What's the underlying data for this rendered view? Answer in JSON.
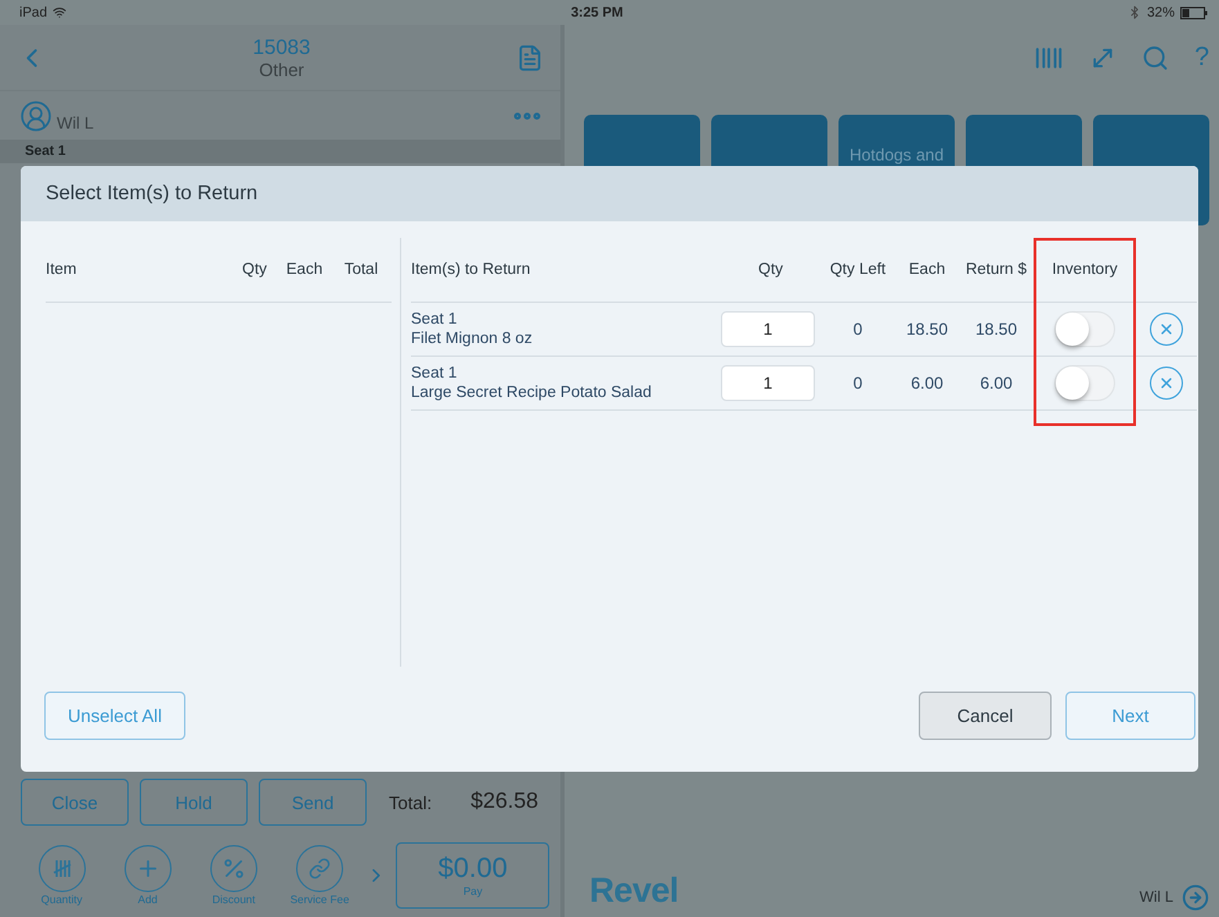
{
  "status_bar": {
    "device": "iPad",
    "time": "3:25 PM",
    "battery": "32%"
  },
  "order_header": {
    "number": "15083",
    "type": "Other"
  },
  "user": {
    "name": "Wil L"
  },
  "seat_label": "Seat 1",
  "toolbar": {
    "help": "?"
  },
  "category_tiles": [
    {
      "kind": "blank"
    },
    {
      "kind": "blank"
    },
    {
      "kind": "labeled",
      "label": "Hotdogs and"
    },
    {
      "kind": "blank"
    },
    {
      "kind": "blank"
    }
  ],
  "order_buttons": [
    "Close",
    "Hold",
    "Send"
  ],
  "total": {
    "label": "Total:",
    "value": "$26.58"
  },
  "actions": [
    {
      "kind": "tally",
      "label": "Quantity"
    },
    {
      "kind": "plus",
      "label": "Add"
    },
    {
      "kind": "percent",
      "label": "Discount"
    },
    {
      "kind": "link",
      "label": "Service Fee"
    }
  ],
  "pay": {
    "amount": "$0.00",
    "label": "Pay"
  },
  "footer": {
    "logo": "Revel",
    "user": "Wil L"
  },
  "dialog": {
    "title": "Select Item(s) to Return",
    "left_columns": [
      "Item",
      "Qty",
      "Each",
      "Total"
    ],
    "right_columns": [
      {
        "label": "Item(s) to Return",
        "highlighted": false
      },
      {
        "label": "Qty",
        "highlighted": false
      },
      {
        "label": "Qty Left",
        "highlighted": false
      },
      {
        "label": "Each",
        "highlighted": false
      },
      {
        "label": "Return $",
        "highlighted": false
      },
      {
        "label": "Inventory",
        "highlighted": true
      }
    ],
    "rows": [
      {
        "seat": "Seat 1",
        "name": "Filet Mignon 8 oz",
        "qty": "1",
        "qty_left": "0",
        "each": "18.50",
        "return": "18.50",
        "inventory": false
      },
      {
        "seat": "Seat 1",
        "name": "Large Secret Recipe Potato Salad",
        "qty": "1",
        "qty_left": "0",
        "each": "6.00",
        "return": "6.00",
        "inventory": false
      }
    ],
    "buttons": {
      "unselect": "Unselect All",
      "cancel": "Cancel",
      "next": "Next"
    }
  }
}
